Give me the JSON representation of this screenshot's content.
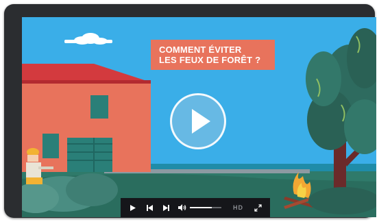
{
  "video": {
    "title_line1": "COMMENT ÉVITER",
    "title_line2": "LES FEUX DE FORÊT ?"
  },
  "controls": {
    "play_icon": "play-icon",
    "previous_icon": "skip-previous-icon",
    "next_icon": "skip-next-icon",
    "volume_icon": "volume-icon",
    "volume_level": 0.7,
    "hd_label": "HD",
    "fullscreen_icon": "fullscreen-icon"
  },
  "colors": {
    "sky": "#3aaee8",
    "title_background": "#e8735c",
    "house_wall": "#e8735c",
    "roof": "#d33a3e",
    "control_bar": "#15161a",
    "frame": "#2b2d30"
  }
}
